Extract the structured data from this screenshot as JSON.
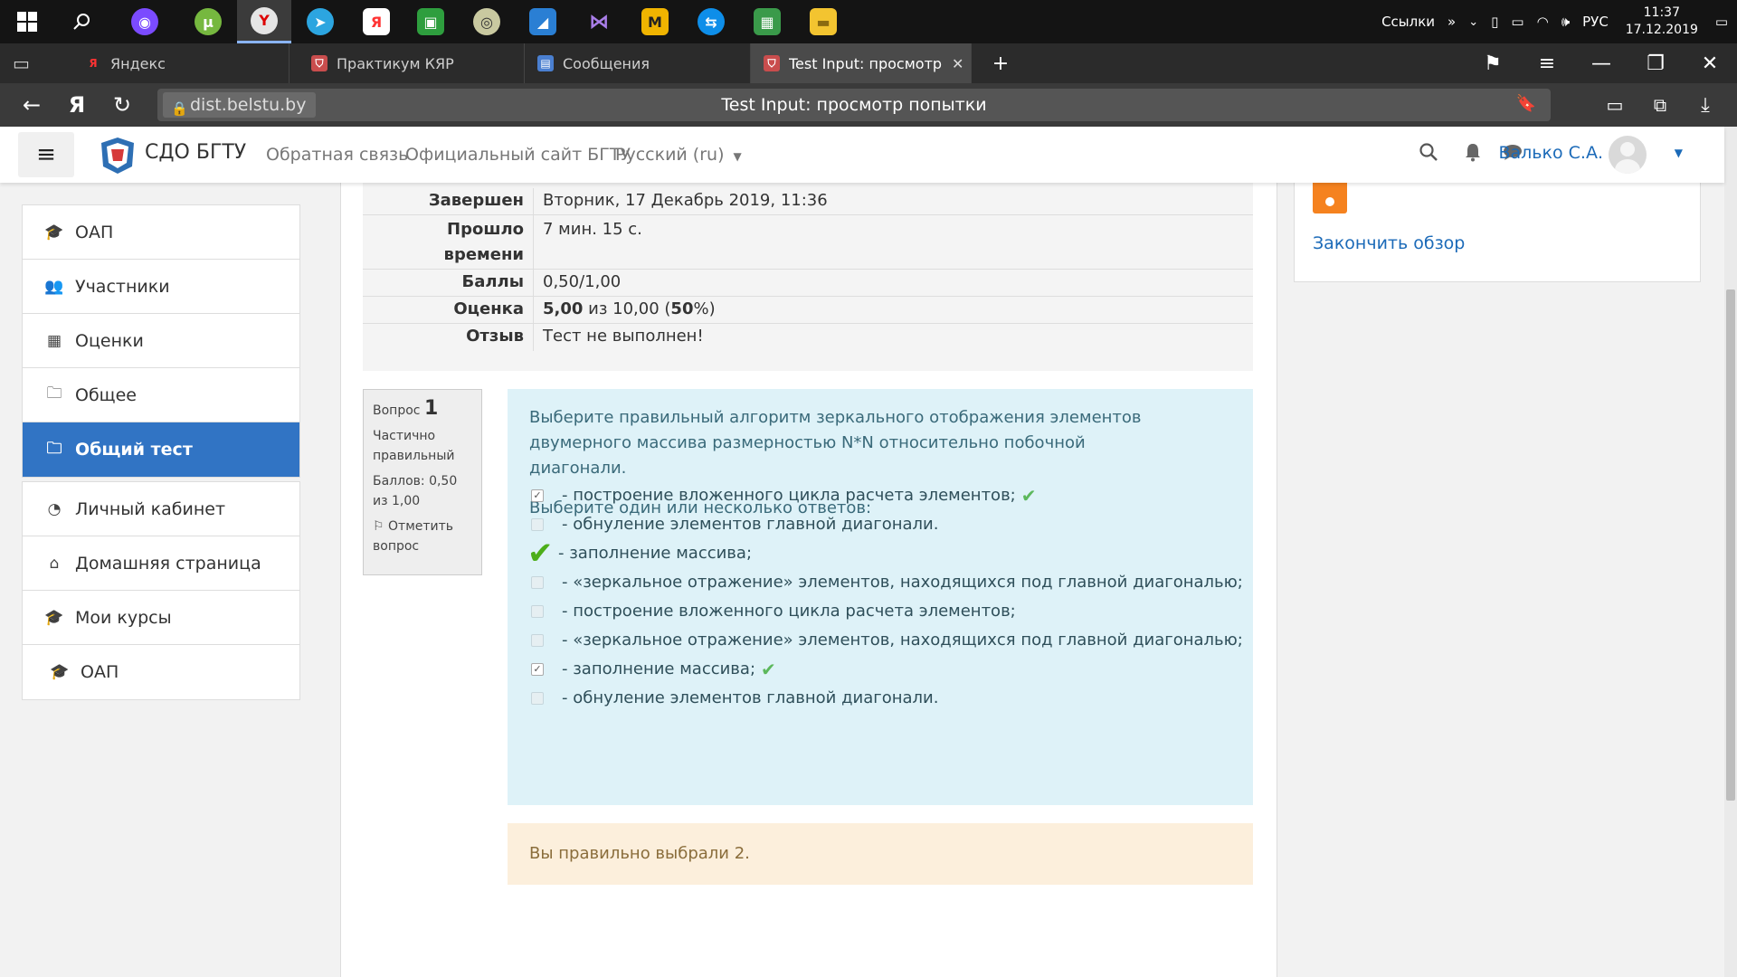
{
  "taskbar": {
    "apps": [
      {
        "icon": "windows-start-icon",
        "glyph": "⊞"
      },
      {
        "icon": "search-icon",
        "glyph": "⚲"
      },
      {
        "icon": "alice-assistant-icon",
        "glyph": "◉",
        "color": "#7b4bff"
      },
      {
        "icon": "utorrent-icon",
        "glyph": "μ",
        "color": "#76b83f"
      },
      {
        "icon": "yandex-browser-icon",
        "glyph": "Y",
        "color": "#e5e5e5"
      },
      {
        "icon": "telegram-icon",
        "glyph": "➤",
        "color": "#2ca5e0"
      },
      {
        "icon": "yandex-icon",
        "glyph": "Я",
        "color": "#ff3333"
      },
      {
        "icon": "money-app-icon",
        "glyph": "▣",
        "color": "#2e9e3e"
      },
      {
        "icon": "chrome-like-icon",
        "glyph": "◎",
        "color": "#c9c9a0"
      },
      {
        "icon": "swift-app-icon",
        "glyph": "◢",
        "color": "#2a7fd4"
      },
      {
        "icon": "visual-studio-icon",
        "glyph": "⋈",
        "color": "#8a5cc7"
      },
      {
        "icon": "m-app-icon",
        "glyph": "M",
        "color": "#f0b400"
      },
      {
        "icon": "teamviewer-icon",
        "glyph": "⇆",
        "color": "#0e8ee9"
      },
      {
        "icon": "spreadsheet-icon",
        "glyph": "▦",
        "color": "#3a9a4a"
      },
      {
        "icon": "file-explorer-icon",
        "glyph": "▬",
        "color": "#f3c430"
      }
    ],
    "tray": {
      "links_label": "Ссылки",
      "lang": "РУС",
      "time": "11:37",
      "date": "17.12.2019"
    }
  },
  "browser": {
    "tabs": [
      {
        "label": "Яндекс",
        "icon": "yandex-icon"
      },
      {
        "label": "Практикум КЯР",
        "icon": "shield-icon"
      },
      {
        "label": "Сообщения",
        "icon": "chat-icon"
      },
      {
        "label": "Test Input: просмотр по",
        "icon": "shield-icon"
      }
    ],
    "domain": "dist.belstu.by",
    "page_title": "Test Input: просмотр попытки"
  },
  "header": {
    "site_name": "СДО БГТУ",
    "links": [
      "Обратная связь",
      "Официальный сайт БГТУ",
      "Русский (ru)"
    ],
    "user_name": "Валько С.А."
  },
  "nav": {
    "group1": [
      {
        "label": "ОАП",
        "icon": "graduation-cap-icon",
        "glyph": "🎓"
      },
      {
        "label": "Участники",
        "icon": "users-icon",
        "glyph": "👥"
      },
      {
        "label": "Оценки",
        "icon": "table-icon",
        "glyph": "▦"
      },
      {
        "label": "Общее",
        "icon": "folder-icon",
        "glyph": "🗀"
      },
      {
        "label": "Общий тест",
        "icon": "folder-icon",
        "glyph": "🗀"
      }
    ],
    "group2": [
      {
        "label": "Личный кабинет",
        "icon": "dashboard-icon",
        "glyph": "◔"
      },
      {
        "label": "Домашняя страница",
        "icon": "home-icon",
        "glyph": "⌂"
      },
      {
        "label": "Мои курсы",
        "icon": "graduation-cap-icon",
        "glyph": "🎓"
      }
    ],
    "group3": [
      {
        "label": "ОАП",
        "icon": "graduation-cap-icon",
        "glyph": "🎓"
      }
    ]
  },
  "summary": {
    "finished_label": "Завершен",
    "finished_value": "Вторник, 17 Декабрь 2019, 11:36",
    "elapsed_label_1": "Прошло",
    "elapsed_label_2": "времени",
    "elapsed_value": "7 мин. 15 с.",
    "marks_label": "Баллы",
    "marks_value": "0,50/1,00",
    "grade_label": "Оценка",
    "grade_bold": "5,00",
    "grade_mid": "из 10,00 (",
    "grade_pct": "50",
    "grade_end": "%)",
    "feedback_label": "Отзыв",
    "feedback_value": "Тест не выполнен!"
  },
  "question": {
    "label": "Вопрос",
    "number": "1",
    "state": "Частично правильный",
    "marks": "Баллов: 0,50 из 1,00",
    "flag_label": "Отметить вопрос",
    "text": "Выберите правильный алгоритм зеркального отображения элементов двумерного массива размерностью N*N относительно побочной диагонали.",
    "prompt": "Выберите один или несколько ответов:",
    "answers": [
      {
        "text": "- построение вложенного цикла расчета элементов;",
        "checked": true,
        "mark": "correct"
      },
      {
        "text": "- обнуление элементов главной диагонали.",
        "checked": false,
        "mark": "none"
      },
      {
        "text": "- заполнение массива;",
        "checked": false,
        "mark": "big-tick"
      },
      {
        "text": "- «зеркальное отражение» элементов, находящихся под главной диагональю;",
        "checked": false,
        "mark": "none"
      },
      {
        "text": "- построение вложенного цикла расчета элементов;",
        "checked": false,
        "mark": "none"
      },
      {
        "text": "- «зеркальное отражение» элементов, находящихся под главной диагональю;",
        "checked": false,
        "mark": "none"
      },
      {
        "text": "- заполнение массива;",
        "checked": true,
        "mark": "correct"
      },
      {
        "text": "- обнуление элементов главной диагонали.",
        "checked": false,
        "mark": "none"
      }
    ],
    "feedback": "Вы правильно выбрали 2."
  },
  "right_block": {
    "finish_review": "Закончить обзор"
  },
  "colors": {
    "accent": "#3174c4",
    "link": "#1b6ab8",
    "question_bg": "#def2f8",
    "feedback_bg": "#fcefdc",
    "correct": "#5cb85c",
    "qnav_orange": "#f5821f"
  }
}
